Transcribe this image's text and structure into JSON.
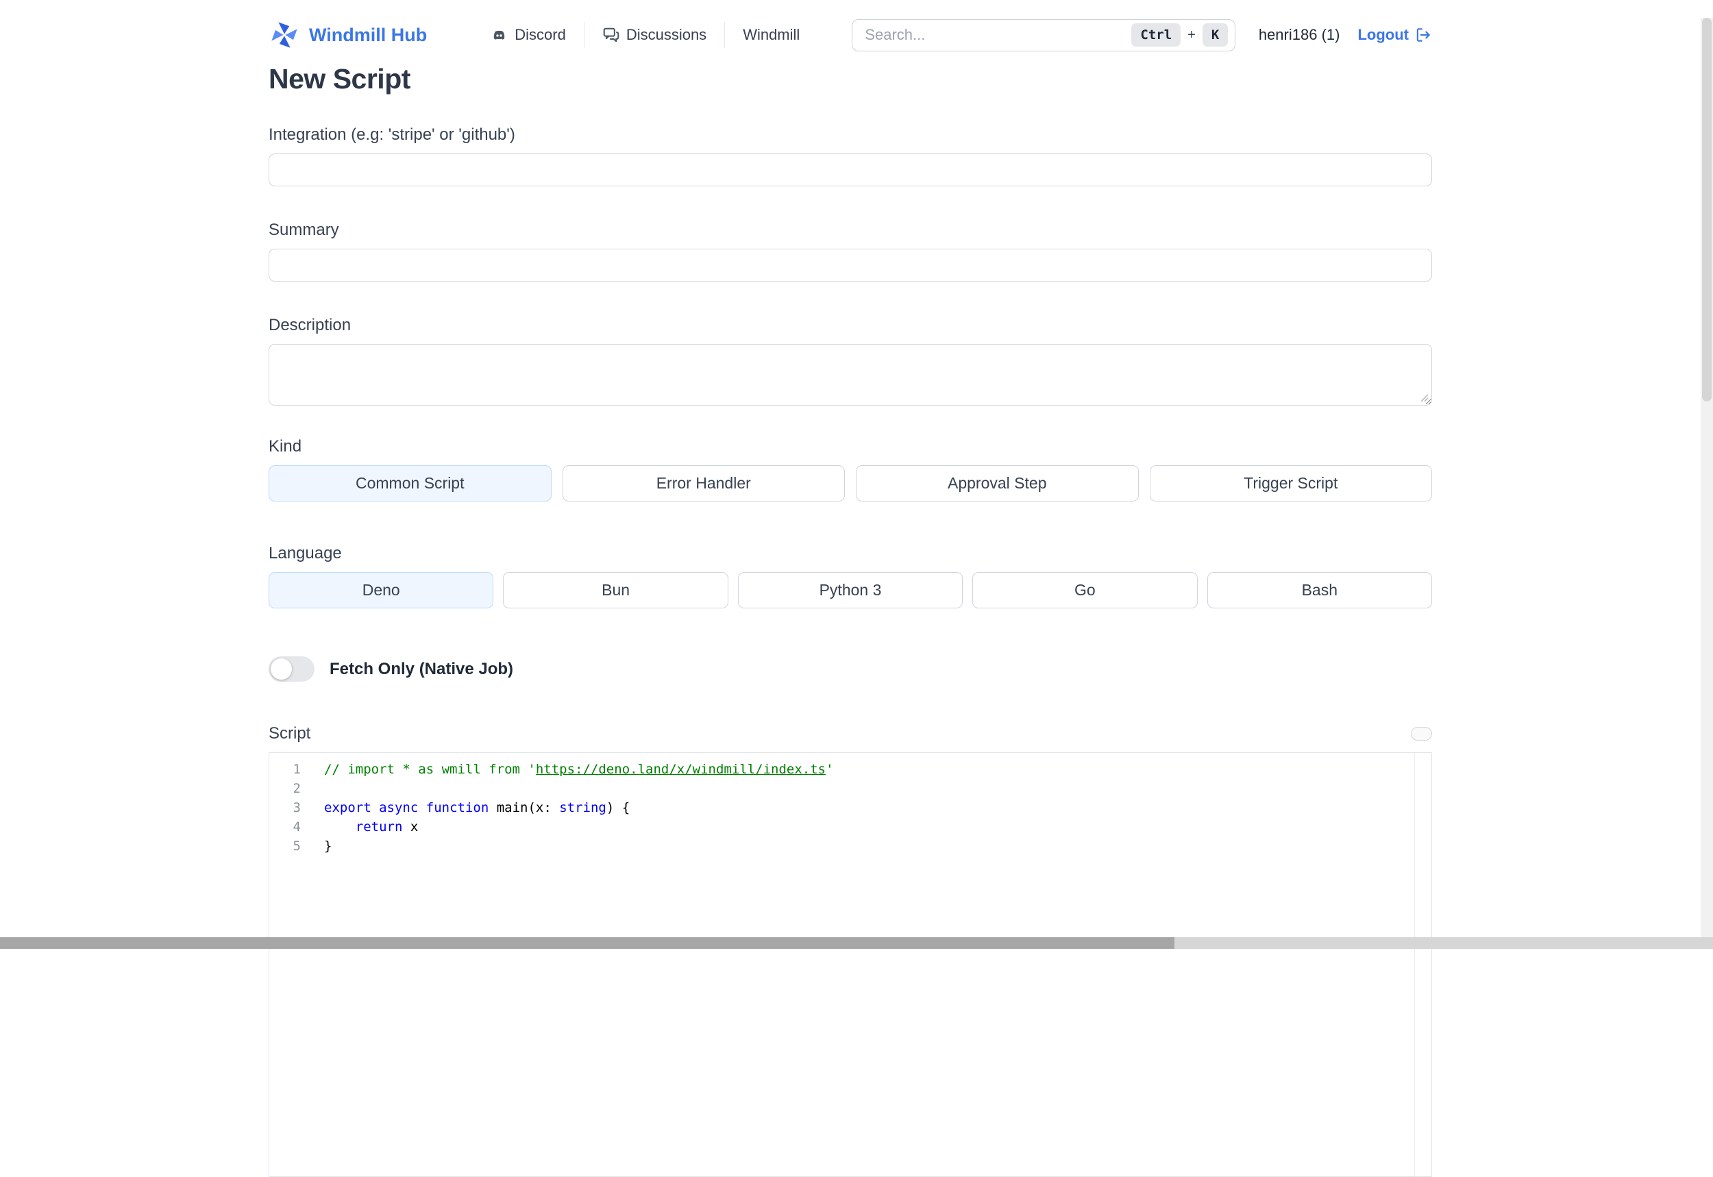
{
  "colors": {
    "brand_blue": "#3b76e8",
    "selected_bg": "#eff6ff",
    "selected_border": "#bfdbfe",
    "comment_green": "#008000",
    "keyword_blue": "#0000ff"
  },
  "header": {
    "brand": "Windmill Hub",
    "nav": [
      {
        "label": "Discord",
        "icon": "discord-icon"
      },
      {
        "label": "Discussions",
        "icon": "discussions-icon"
      },
      {
        "label": "Windmill",
        "icon": null
      }
    ],
    "search": {
      "placeholder": "Search...",
      "shortcut_keys": [
        "Ctrl",
        "K"
      ],
      "shortcut_separator": "+"
    },
    "user": "henri186 (1)",
    "logout_label": "Logout"
  },
  "page_title": "New Script",
  "form": {
    "integration": {
      "label": "Integration (e.g: 'stripe' or 'github')",
      "value": ""
    },
    "summary": {
      "label": "Summary",
      "value": ""
    },
    "description": {
      "label": "Description",
      "value": ""
    },
    "kind": {
      "label": "Kind",
      "selected": "Common Script",
      "options": [
        "Common Script",
        "Error Handler",
        "Approval Step",
        "Trigger Script"
      ]
    },
    "language": {
      "label": "Language",
      "selected": "Deno",
      "options": [
        "Deno",
        "Bun",
        "Python 3",
        "Go",
        "Bash"
      ]
    },
    "fetch_only": {
      "label": "Fetch Only (Native Job)",
      "enabled": false
    },
    "script": {
      "label": "Script"
    }
  },
  "editor": {
    "lines": [
      {
        "num": "1",
        "tokens": [
          [
            "comment",
            "// import * as wmill from '"
          ],
          [
            "comment-link",
            "https://deno.land/x/windmill/index.ts"
          ],
          [
            "comment",
            "'"
          ]
        ]
      },
      {
        "num": "2",
        "tokens": []
      },
      {
        "num": "3",
        "tokens": [
          [
            "keyword",
            "export"
          ],
          [
            "plain",
            " "
          ],
          [
            "keyword",
            "async"
          ],
          [
            "plain",
            " "
          ],
          [
            "keyword",
            "function"
          ],
          [
            "plain",
            " main(x: "
          ],
          [
            "keyword",
            "string"
          ],
          [
            "plain",
            ") {"
          ]
        ]
      },
      {
        "num": "4",
        "tokens": [
          [
            "plain",
            "    "
          ],
          [
            "keyword",
            "return"
          ],
          [
            "plain",
            " x"
          ]
        ]
      },
      {
        "num": "5",
        "tokens": [
          [
            "plain",
            "}"
          ]
        ]
      }
    ]
  }
}
